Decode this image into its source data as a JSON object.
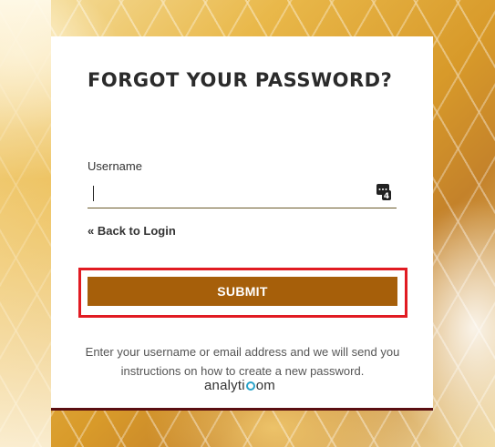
{
  "form": {
    "title": "FORGOT YOUR PASSWORD?",
    "username_label": "Username",
    "username_value": "",
    "back_link": "« Back to Login",
    "submit_label": "SUBMIT",
    "instructions": "Enter your username or email address and we will send you instructions on how to create a new password."
  },
  "password_manager_icon": {
    "name": "password-manager-icon",
    "badge": "4"
  },
  "logo": {
    "text_prefix": "analyti",
    "text_suffix": "om",
    "accent_color": "#29a3c9"
  },
  "colors": {
    "submit_button": "#a65f0a",
    "highlight_outline": "#e11b22",
    "card_bottom_border": "#5a0f12"
  }
}
